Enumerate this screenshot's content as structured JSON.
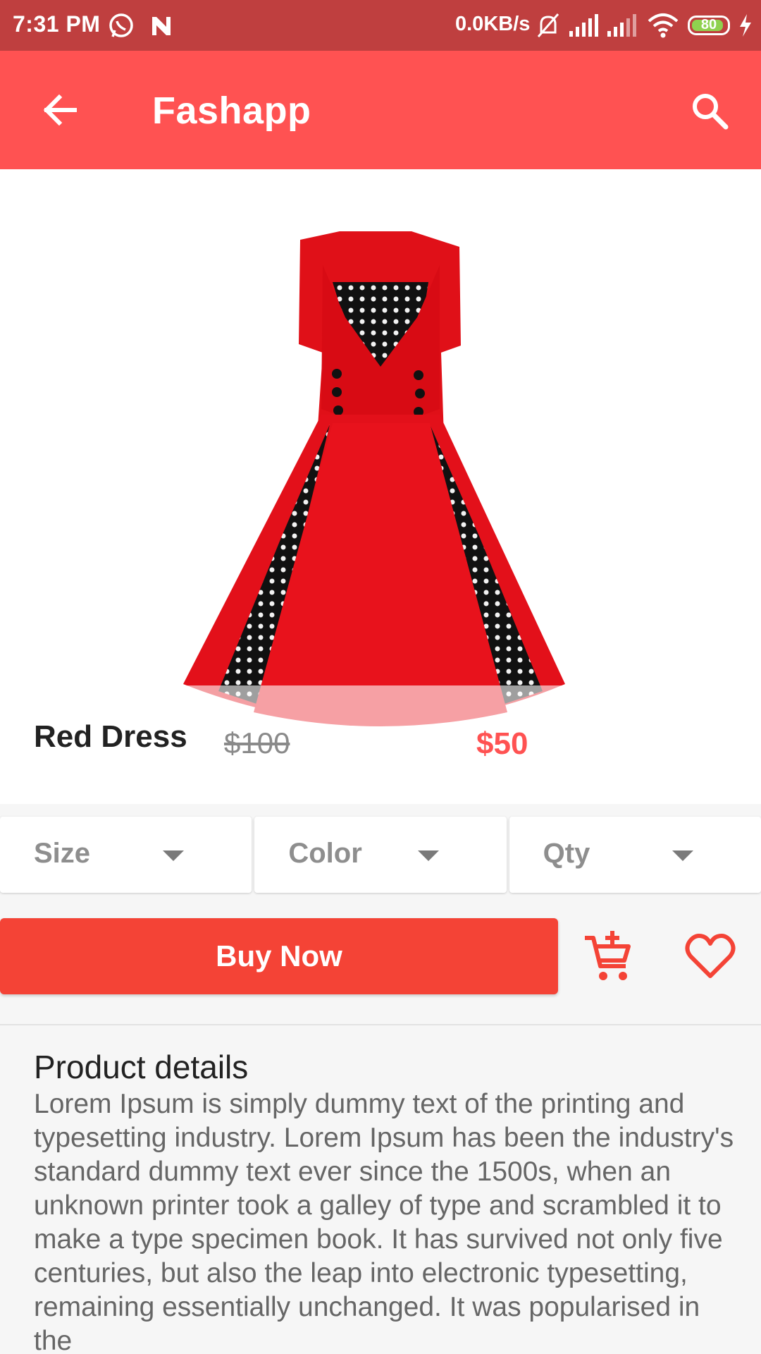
{
  "status_bar": {
    "time": "7:31 PM",
    "network_speed": "0.0KB/s",
    "battery": "80",
    "icons": [
      "whatsapp-icon",
      "notification-n-icon",
      "bell-off-icon",
      "signal-icon",
      "signal-icon",
      "wifi-icon",
      "battery-icon",
      "charging-icon"
    ]
  },
  "app_bar": {
    "title": "Fashapp",
    "back_icon": "arrow-back-icon",
    "search_icon": "search-icon",
    "color": "#ff5252"
  },
  "product": {
    "name": "Red Dress",
    "old_price": "$100",
    "price": "$50",
    "image": "red-polka-dot-dress"
  },
  "selectors": [
    {
      "label": "Size"
    },
    {
      "label": "Color"
    },
    {
      "label": "Qty"
    }
  ],
  "actions": {
    "buy_label": "Buy Now",
    "cart_icon": "add-to-cart-icon",
    "favorite_icon": "heart-icon",
    "accent": "#f44336"
  },
  "details": {
    "title": "Product details",
    "body": "Lorem Ipsum is simply dummy text of the printing and typesetting industry. Lorem Ipsum has been the industry's standard dummy text ever since the 1500s, when an unknown printer took a galley of type and scrambled it to make a type specimen book. It has survived not only five centuries, but also the leap into electronic typesetting, remaining essentially unchanged. It was popularised in the"
  }
}
